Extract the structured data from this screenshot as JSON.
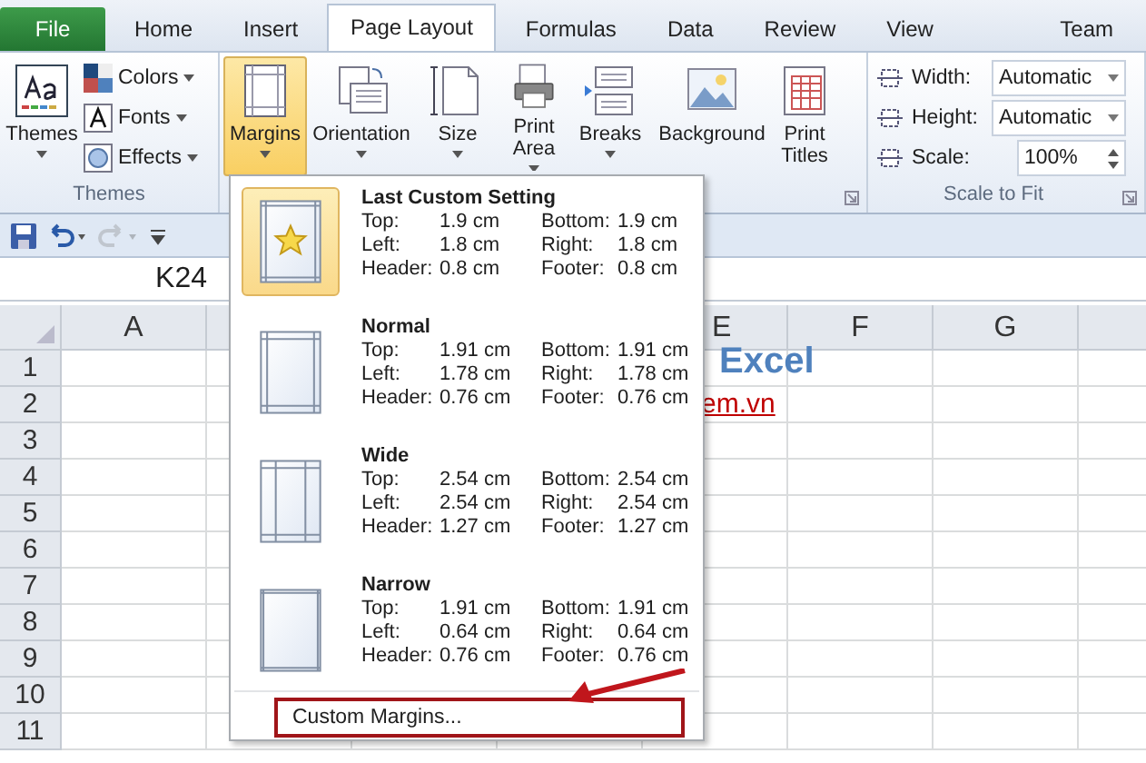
{
  "tabs": [
    {
      "label": "File",
      "kind": "file",
      "selected": false
    },
    {
      "label": "Home",
      "kind": "tab",
      "selected": false
    },
    {
      "label": "Insert",
      "kind": "tab",
      "selected": false
    },
    {
      "label": "Page Layout",
      "kind": "tab",
      "selected": true
    },
    {
      "label": "Formulas",
      "kind": "tab",
      "selected": false
    },
    {
      "label": "Data",
      "kind": "tab",
      "selected": false
    },
    {
      "label": "Review",
      "kind": "tab",
      "selected": false
    },
    {
      "label": "View",
      "kind": "tab",
      "selected": false
    },
    {
      "label": "Team",
      "kind": "tab",
      "selected": false
    }
  ],
  "themes_group": {
    "label": "Themes",
    "large": {
      "label": "Themes",
      "has_menu": true
    },
    "small": [
      {
        "label": "Colors",
        "has_menu": true
      },
      {
        "label": "Fonts",
        "has_menu": true
      },
      {
        "label": "Effects",
        "has_menu": true
      }
    ]
  },
  "page_setup_group": {
    "dialog_launcher": true,
    "buttons": [
      {
        "label": "Margins",
        "kind": "margins",
        "has_menu": true,
        "selected": true
      },
      {
        "label": "Orientation",
        "kind": "orientation",
        "has_menu": true,
        "selected": false
      },
      {
        "label": "Size",
        "kind": "size",
        "has_menu": true,
        "selected": false
      },
      {
        "label": "Print Area",
        "kind": "print-area",
        "has_menu": true,
        "selected": false
      },
      {
        "label": "Breaks",
        "kind": "breaks",
        "has_menu": true,
        "selected": false
      },
      {
        "label": "Background",
        "kind": "background",
        "has_menu": false,
        "selected": false
      },
      {
        "label": "Print Titles",
        "kind": "print-titles",
        "has_menu": false,
        "selected": false
      }
    ]
  },
  "scale_group": {
    "label": "Scale to Fit",
    "dialog_launcher": true,
    "rows": [
      {
        "label": "Width:",
        "value": "Automatic",
        "kind": "dropdown"
      },
      {
        "label": "Height:",
        "value": "Automatic",
        "kind": "dropdown"
      },
      {
        "label": "Scale:",
        "value": "100%",
        "kind": "spinner"
      }
    ]
  },
  "quick_access": [
    {
      "kind": "save",
      "disabled": false
    },
    {
      "kind": "undo",
      "disabled": false
    },
    {
      "kind": "redo",
      "disabled": true
    },
    {
      "kind": "customize",
      "disabled": false
    }
  ],
  "name_box": "K24",
  "sheet": {
    "columns": [
      {
        "label": "A"
      },
      {
        "label": "E"
      },
      {
        "label": "F"
      },
      {
        "label": "G"
      }
    ],
    "rows": [
      {
        "label": "1",
        "text": "Excel",
        "kind": "heading"
      },
      {
        "label": "2",
        "text": "em.vn",
        "kind": "link"
      },
      {
        "label": "3"
      },
      {
        "label": "4"
      },
      {
        "label": "5"
      },
      {
        "label": "6"
      },
      {
        "label": "7"
      },
      {
        "label": "8"
      },
      {
        "label": "9"
      },
      {
        "label": "10"
      },
      {
        "label": "11"
      }
    ]
  },
  "margins_menu": {
    "presets": [
      {
        "name": "Last Custom Setting",
        "kind": "custom",
        "selected": true,
        "values": [
          [
            "Top:",
            "1.9 cm",
            "Bottom:",
            "1.9 cm"
          ],
          [
            "Left:",
            "1.8 cm",
            "Right:",
            "1.8 cm"
          ],
          [
            "Header:",
            "0.8 cm",
            "Footer:",
            "0.8 cm"
          ]
        ]
      },
      {
        "name": "Normal",
        "kind": "normal",
        "selected": false,
        "values": [
          [
            "Top:",
            "1.91 cm",
            "Bottom:",
            "1.91 cm"
          ],
          [
            "Left:",
            "1.78 cm",
            "Right:",
            "1.78 cm"
          ],
          [
            "Header:",
            "0.76 cm",
            "Footer:",
            "0.76 cm"
          ]
        ]
      },
      {
        "name": "Wide",
        "kind": "wide",
        "selected": false,
        "values": [
          [
            "Top:",
            "2.54 cm",
            "Bottom:",
            "2.54 cm"
          ],
          [
            "Left:",
            "2.54 cm",
            "Right:",
            "2.54 cm"
          ],
          [
            "Header:",
            "1.27 cm",
            "Footer:",
            "1.27 cm"
          ]
        ]
      },
      {
        "name": "Narrow",
        "kind": "narrow",
        "selected": false,
        "values": [
          [
            "Top:",
            "1.91 cm",
            "Bottom:",
            "1.91 cm"
          ],
          [
            "Left:",
            "0.64 cm",
            "Right:",
            "0.64 cm"
          ],
          [
            "Header:",
            "0.76 cm",
            "Footer:",
            "0.76 cm"
          ]
        ]
      }
    ],
    "footer": {
      "label": "Custom Margins...",
      "annotated": true
    }
  }
}
